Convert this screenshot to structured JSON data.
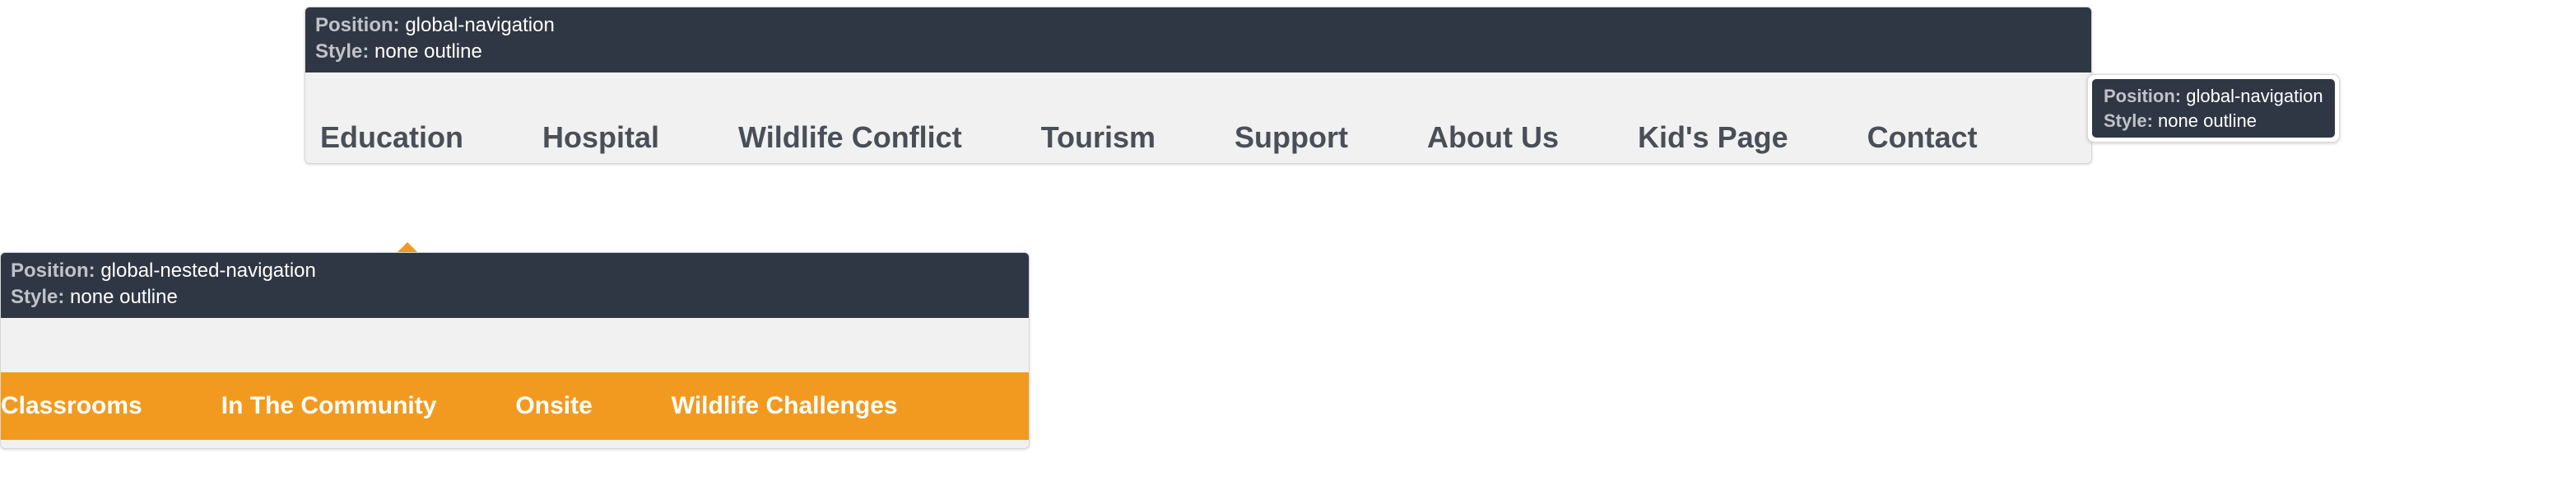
{
  "labels": {
    "position": "Position:",
    "style": "Style:"
  },
  "global_nav": {
    "position": "global-navigation",
    "style": "none outline",
    "items": [
      "Education",
      "Hospital",
      "Wildlife Conflict",
      "Tourism",
      "Support",
      "About Us",
      "Kid's Page",
      "Contact"
    ]
  },
  "tooltip": {
    "position": "global-navigation",
    "style": "none outline"
  },
  "nested_nav": {
    "position": "global-nested-navigation",
    "style": "none outline",
    "items": [
      "Classrooms",
      "In The Community",
      "Onsite",
      "Wildlife Challenges"
    ]
  },
  "colors": {
    "accent": "#f29a1f",
    "panel": "#2f3744"
  }
}
